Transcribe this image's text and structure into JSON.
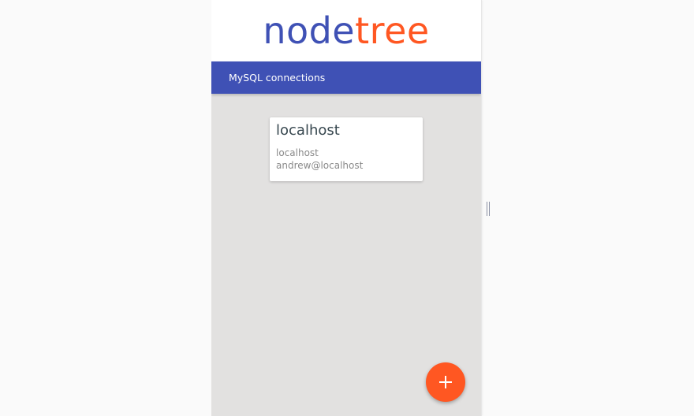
{
  "brand": {
    "logo_part1": "node",
    "logo_part2": "tree",
    "colors": {
      "primary": "#3f51b5",
      "accent": "#ff5722"
    }
  },
  "toolbar": {
    "title": "MySQL connections"
  },
  "connections": [
    {
      "name": "localhost",
      "host": "localhost",
      "user": "andrew@localhost"
    }
  ],
  "fab": {
    "icon": "plus-icon"
  },
  "resize_handle": {
    "icon": "drag-handle-icon"
  }
}
